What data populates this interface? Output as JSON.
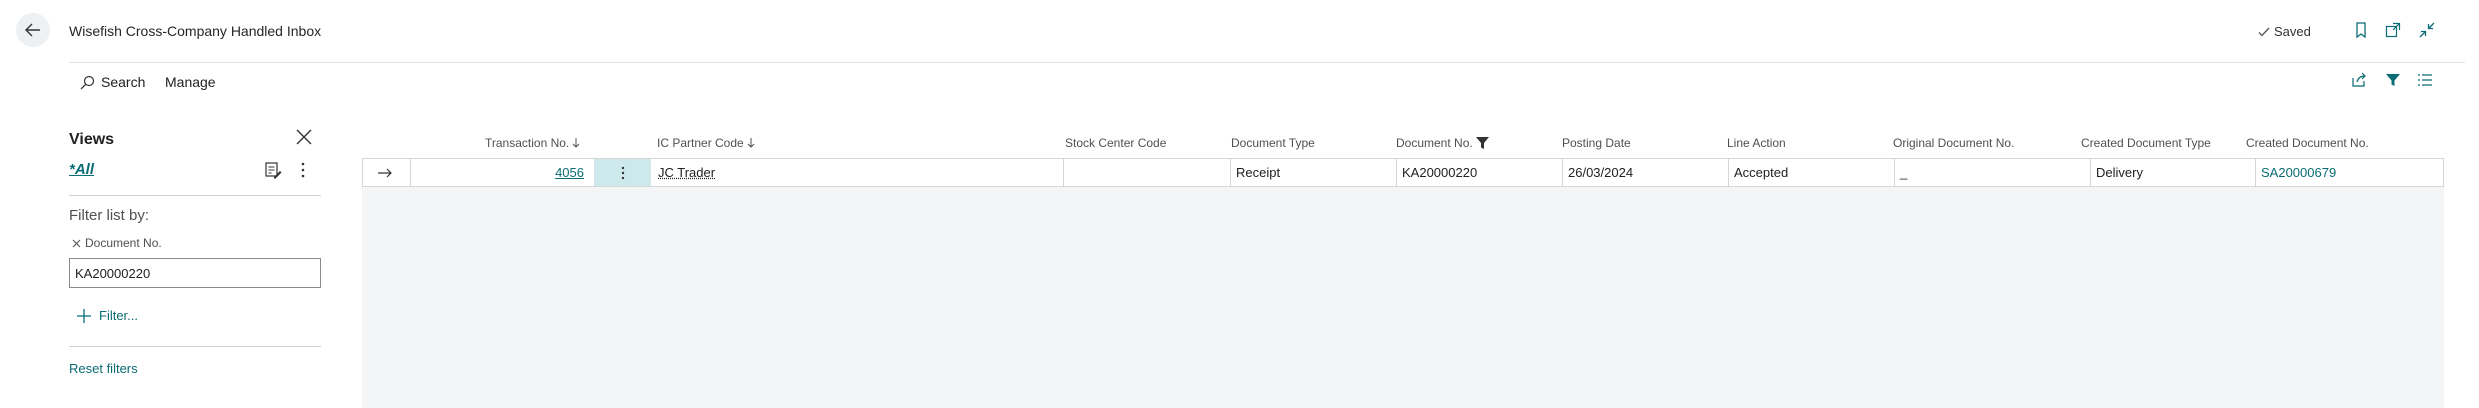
{
  "header": {
    "title": "Wisefish Cross-Company Handled Inbox",
    "saved_label": "Saved"
  },
  "actions": {
    "search_label": "Search",
    "manage_label": "Manage"
  },
  "views": {
    "title": "Views",
    "current": "*All",
    "filter_list_by": "Filter list by:",
    "filter_field": "Document No.",
    "filter_value": "KA20000220",
    "add_filter_label": "Filter...",
    "reset_label": "Reset filters"
  },
  "table": {
    "columns": [
      "Transaction No.",
      "IC Partner Code",
      "Stock Center Code",
      "Document Type",
      "Document No.",
      "Posting Date",
      "Line Action",
      "Original Document No.",
      "Created Document Type",
      "Created Document No."
    ],
    "row": {
      "transaction_no": "4056",
      "ic_partner_code": "JC Trader",
      "stock_center_code": "",
      "document_type": "Receipt",
      "document_no": "KA20000220",
      "posting_date": "26/03/2024",
      "line_action": "Accepted",
      "original_document_no": "_",
      "created_document_type": "Delivery",
      "created_document_no": "SA20000679"
    }
  },
  "colors": {
    "accent": "#0a6c74",
    "selected_cell": "#cde9ec",
    "grid_background": "#f4f5f6"
  },
  "icons": {
    "back": "back-arrow-icon",
    "bookmark": "bookmark-icon",
    "open_new": "open-in-new-window-icon",
    "collapse": "collapse-icon",
    "share": "share-icon",
    "filter": "filter-icon",
    "list": "list-icon",
    "search": "search-icon",
    "close": "close-icon",
    "edit_view": "edit-view-icon",
    "more": "more-vertical-icon",
    "add": "plus-icon",
    "row_arrow": "row-arrow-icon",
    "saved_check": "checkmark-icon"
  }
}
